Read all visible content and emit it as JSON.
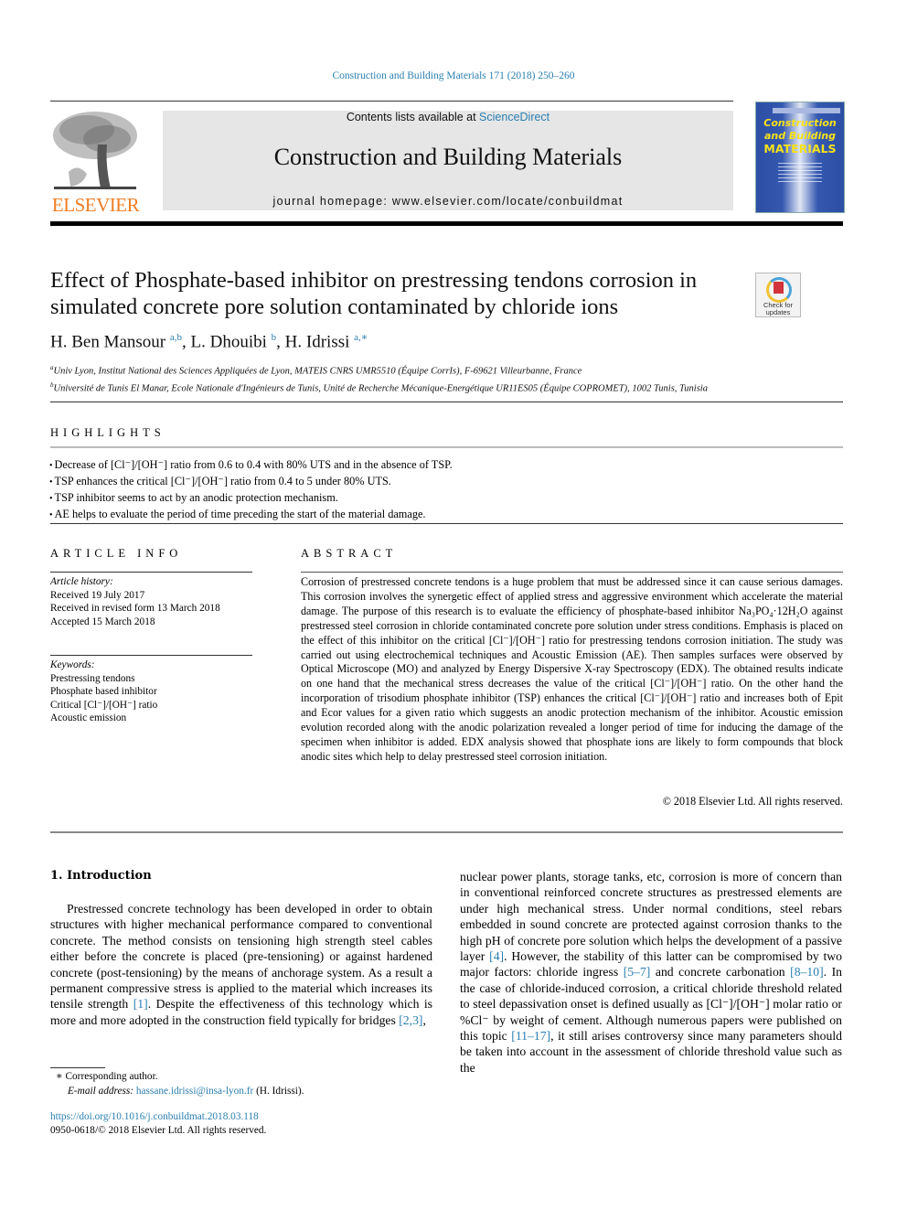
{
  "running_head": "Construction and Building Materials 171 (2018) 250–260",
  "header": {
    "publisher_logo_text": "ELSEVIER",
    "contents_prefix": "Contents lists available at ",
    "contents_link": "ScienceDirect",
    "journal_name": "Construction and Building Materials",
    "homepage_line": "journal homepage: www.elsevier.com/locate/conbuildmat",
    "cover": {
      "line1": "Construction",
      "line2": "and Building",
      "line3": "MATERIALS"
    },
    "brand_color": "#f07d23",
    "link_color": "#2a7fb0"
  },
  "article": {
    "title": "Effect of Phosphate-based inhibitor on prestressing tendons corrosion in simulated concrete pore solution contaminated by chloride ions",
    "crossmark_label_1": "Check for",
    "crossmark_label_2": "updates",
    "authors": [
      {
        "name": "H. Ben Mansour",
        "sup": "a,b"
      },
      {
        "name": "L. Dhouibi",
        "sup": "b"
      },
      {
        "name": "H. Idrissi",
        "sup": "a,∗"
      }
    ],
    "affiliations": [
      {
        "sup": "a",
        "text": "Univ Lyon, Institut National des Sciences Appliquées de Lyon, MATEIS CNRS UMR5510 (Équipe CorrIs), F-69621 Villeurbanne, France"
      },
      {
        "sup": "b",
        "text": "Université de Tunis El Manar, Ecole Nationale d'Ingénieurs de Tunis, Unité de Recherche Mécanique-Energétique UR11ES05 (Équipe COPROMET), 1002 Tunis, Tunisia"
      }
    ]
  },
  "highlights": {
    "heading": "HIGHLIGHTS",
    "items": [
      "Decrease of [Cl⁻]/[OH⁻] ratio from 0.6 to 0.4 with 80% UTS and in the absence of TSP.",
      "TSP enhances the critical [Cl⁻]/[OH⁻] ratio from 0.4 to 5 under 80% UTS.",
      "TSP inhibitor seems to act by an anodic protection mechanism.",
      "AE helps to evaluate the period of time preceding the start of the material damage."
    ]
  },
  "article_info": {
    "heading": "ARTICLE INFO",
    "history_label": "Article history:",
    "history": [
      "Received 19 July 2017",
      "Received in revised form 13 March 2018",
      "Accepted 15 March 2018"
    ],
    "keywords_label": "Keywords:",
    "keywords": [
      "Prestressing tendons",
      "Phosphate based inhibitor",
      "Critical [Cl⁻]/[OH⁻] ratio",
      "Acoustic emission"
    ]
  },
  "abstract": {
    "heading": "ABSTRACT",
    "text": "Corrosion of prestressed concrete tendons is a huge problem that must be addressed since it can cause serious damages. This corrosion involves the synergetic effect of applied stress and aggressive environment which accelerate the material damage. The purpose of this research is to evaluate the efficiency of phosphate-based inhibitor Na₃PO₄·12H₂O against prestressed steel corrosion in chloride contaminated concrete pore solution under stress conditions. Emphasis is placed on the effect of this inhibitor on the critical [Cl⁻]/[OH⁻] ratio for prestressing tendons corrosion initiation. The study was carried out using electrochemical techniques and Acoustic Emission (AE). Then samples surfaces were observed by Optical Microscope (MO) and analyzed by Energy Dispersive X-ray Spectroscopy (EDX). The obtained results indicate on one hand that the mechanical stress decreases the value of the critical [Cl⁻]/[OH⁻] ratio. On the other hand the incorporation of trisodium phosphate inhibitor (TSP) enhances the critical [Cl⁻]/[OH⁻] ratio and increases both of Epit and Ecor values for a given ratio which suggests an anodic protection mechanism of the inhibitor. Acoustic emission evolution recorded along with the anodic polarization revealed a longer period of time for inducing the damage of the specimen when inhibitor is added. EDX analysis showed that phosphate ions are likely to form compounds that block anodic sites which help to delay prestressed steel corrosion initiation.",
    "copyright": "© 2018 Elsevier Ltd. All rights reserved."
  },
  "introduction": {
    "heading": "1. Introduction",
    "left_parts": [
      "Prestressed concrete technology has been developed in order to obtain structures with higher mechanical performance compared to conventional concrete. The method consists on tensioning high strength steel cables either before the concrete is placed (pre-tensioning) or against hardened concrete (post-tensioning) by the means of anchorage system. As a result a permanent compressive stress is applied to the material which increases its tensile strength ",
      "[1]",
      ". Despite the effectiveness of this technology which is more and more adopted in the construction field typically for bridges ",
      "[2,3]",
      ","
    ],
    "right_parts": [
      "nuclear power plants, storage tanks, etc, corrosion is more of concern than in conventional reinforced concrete structures as prestressed elements are under high mechanical stress. Under normal conditions, steel rebars embedded in sound concrete are protected against corrosion thanks to the high pH of concrete pore solution which helps the development of a passive layer ",
      "[4]",
      ". However, the stability of this latter can be compromised by two major factors: chloride ingress ",
      "[5–7]",
      " and concrete carbonation ",
      "[8–10]",
      ". In the case of chloride-induced corrosion, a critical chloride threshold related to steel depassivation onset is defined usually as [Cl⁻]/[OH⁻] molar ratio or %Cl⁻ by weight of cement. Although numerous papers were published on this topic ",
      "[11–17]",
      ", it still arises controversy since many parameters should be taken into account in the assessment of chloride threshold value such as the"
    ]
  },
  "footnotes": {
    "corresponding": "∗ Corresponding author.",
    "email_label": "E-mail address: ",
    "email": "hassane.idrissi@insa-lyon.fr",
    "email_suffix": " (H. Idrissi).",
    "doi": "https://doi.org/10.1016/j.conbuildmat.2018.03.118",
    "issn_line": "0950-0618/© 2018 Elsevier Ltd. All rights reserved."
  }
}
